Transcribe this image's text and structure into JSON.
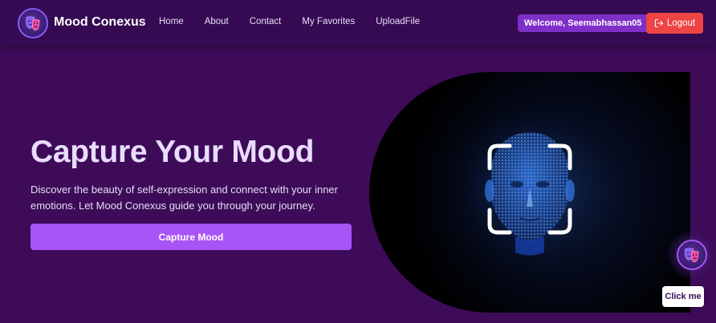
{
  "app": {
    "brand": "Mood Conexus",
    "logo_icon": "theater-masks-icon"
  },
  "nav": {
    "links": [
      {
        "label": "Home"
      },
      {
        "label": "About"
      },
      {
        "label": "Contact"
      },
      {
        "label": "My Favorites"
      },
      {
        "label": "UploadFile"
      }
    ],
    "welcome_text": "Welcome, Seemabhassan05",
    "logout_label": "Logout",
    "logout_icon": "logout-icon"
  },
  "hero": {
    "title": "Capture Your Mood",
    "description": "Discover the beauty of self-expression and connect with your inner emotions. Let Mood Conexus guide you through your journey.",
    "button_label": "Capture Mood",
    "image_icon": "face-scan-icon"
  },
  "floating": {
    "button_icon": "theater-masks-icon",
    "tooltip": "Click me"
  },
  "colors": {
    "background": "#3d0b58",
    "navbar": "#360a52",
    "accent": "#a855f7",
    "welcome_badge": "#7e2fc7",
    "logout": "#ef4444",
    "title": "#e9dcff"
  }
}
